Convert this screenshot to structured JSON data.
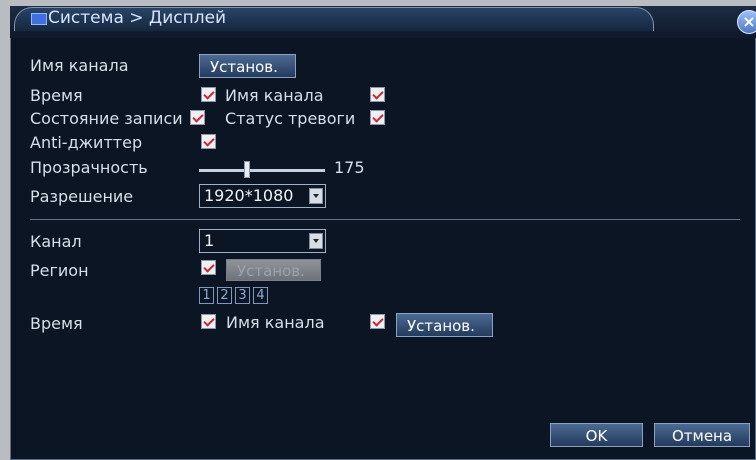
{
  "window": {
    "title": "Система > Дисплей",
    "close_glyph": "×"
  },
  "display_settings": {
    "channel_name_label": "Имя канала",
    "channel_name_button": "Установ.",
    "time_label": "Время",
    "time_checked": true,
    "channel_name_check_label": "Имя канала",
    "channel_name_checked": true,
    "record_status_label": "Состояние записи",
    "record_status_checked": true,
    "alarm_status_label": "Статус тревоги",
    "alarm_status_checked": true,
    "anti_jitter_label": "Anti-джиттер",
    "anti_jitter_checked": true,
    "transparency_label": "Прозрачность",
    "transparency_value": "175",
    "resolution_label": "Разрешение",
    "resolution_value": "1920*1080"
  },
  "channel_settings": {
    "channel_label": "Канал",
    "channel_value": "1",
    "region_label": "Регион",
    "region_checked": true,
    "region_button": "Установ.",
    "region_numbers": [
      "1",
      "2",
      "3",
      "4"
    ],
    "time_label": "Время",
    "time_checked": true,
    "channel_name_label": "Имя канала",
    "channel_name_checked": true,
    "set_button": "Установ."
  },
  "footer": {
    "ok_label": "OK",
    "cancel_label": "Отмена"
  },
  "colors": {
    "background": "#0b1524",
    "accent": "#3f6fe0",
    "check_mark": "#c5283a"
  },
  "icons": {
    "title": "window-icon",
    "close": "close-icon",
    "dropdown": "chevron-down-icon",
    "checkbox": "checkmark-icon"
  }
}
